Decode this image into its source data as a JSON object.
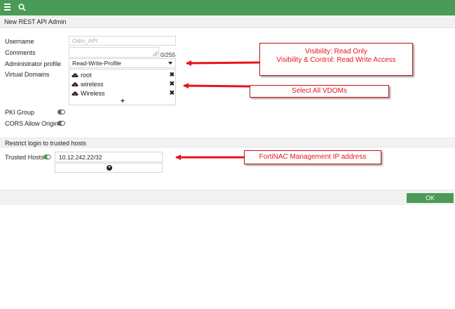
{
  "topbar": {
    "menu_icon": "menu-icon",
    "search_icon": "search-icon",
    "color": "#4a9a58"
  },
  "page": {
    "title": "New REST API Admin"
  },
  "form": {
    "username": {
      "label": "Username",
      "value": "Odin_API"
    },
    "comments": {
      "label": "Comments",
      "counter": "0/255"
    },
    "admin_profile": {
      "label": "Administrator profile",
      "value": "Read-Write-Profile"
    },
    "virtual_domains": {
      "label": "Virtual Domains",
      "items": [
        {
          "label": "root"
        },
        {
          "label": "wireless"
        },
        {
          "label": "Wireless"
        }
      ],
      "add_label": "+"
    },
    "pki_group": {
      "label": "PKI Group",
      "enabled": false
    },
    "cors": {
      "label": "CORS Allow Origin",
      "enabled": false
    }
  },
  "trusted": {
    "section_title": "Restrict login to trusted hosts",
    "label": "Trusted Hosts",
    "enabled": true,
    "hosts": [
      "10.12.242.22/32"
    ]
  },
  "footer": {
    "ok_label": "OK"
  },
  "annotations": {
    "profile_note": {
      "line1": "Visibility: Read Only",
      "line2": "Visibility & Control: Read Write Access"
    },
    "vdom_note": "Select All VDOMs",
    "ip_note": "FortiNAC Management IP address",
    "color": "#e5151c"
  }
}
